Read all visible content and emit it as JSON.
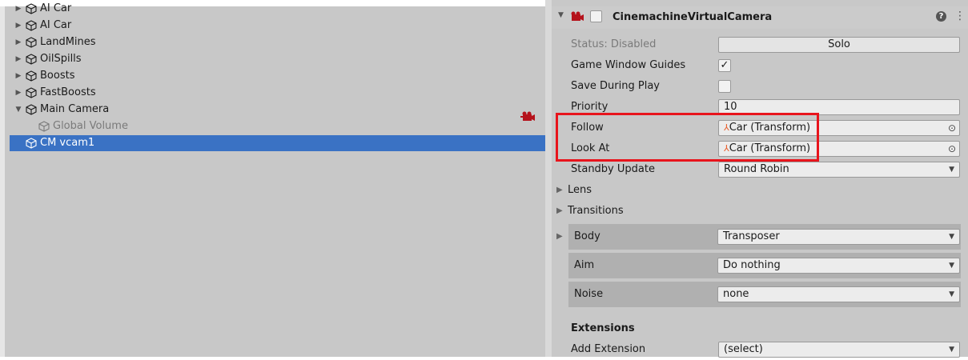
{
  "hierarchy": {
    "items": [
      {
        "label": "AI Car",
        "expand": "collapsed",
        "state": "partial"
      },
      {
        "label": "AI Car",
        "expand": "collapsed",
        "state": "normal"
      },
      {
        "label": "LandMines",
        "expand": "collapsed",
        "state": "normal"
      },
      {
        "label": "OilSpills",
        "expand": "collapsed",
        "state": "normal"
      },
      {
        "label": "Boosts",
        "expand": "collapsed",
        "state": "normal"
      },
      {
        "label": "FastBoosts",
        "expand": "collapsed",
        "state": "normal"
      },
      {
        "label": "Main Camera",
        "expand": "expanded",
        "state": "normal"
      },
      {
        "label": "Global Volume",
        "expand": "none",
        "state": "disabled"
      },
      {
        "label": "CM vcam1",
        "expand": "none",
        "state": "selected"
      }
    ]
  },
  "inspector": {
    "component_title": "CinemachineVirtualCamera",
    "status_label": "Status: Disabled",
    "solo_label": "Solo",
    "game_window_guides_label": "Game Window Guides",
    "game_window_guides_checked": "✓",
    "save_during_play_label": "Save During Play",
    "priority_label": "Priority",
    "priority_value": "10",
    "follow_label": "Follow",
    "follow_value": "Car (Transform)",
    "look_at_label": "Look At",
    "look_at_value": "Car (Transform)",
    "standby_update_label": "Standby Update",
    "standby_update_value": "Round Robin",
    "lens_label": "Lens",
    "transitions_label": "Transitions",
    "body_label": "Body",
    "body_value": "Transposer",
    "aim_label": "Aim",
    "aim_value": "Do nothing",
    "noise_label": "Noise",
    "noise_value": "none",
    "extensions_label": "Extensions",
    "add_extension_label": "Add Extension",
    "add_extension_value": "(select)"
  },
  "icons": {
    "collapsed": "▶",
    "expanded": "▼",
    "dropdown": "▼",
    "help": "?",
    "menu": "⋮",
    "object_picker": "⊙"
  },
  "colors": {
    "selection": "#3a72c4",
    "highlight_box": "#e8141c",
    "panel_bg": "#c8c8c8"
  }
}
